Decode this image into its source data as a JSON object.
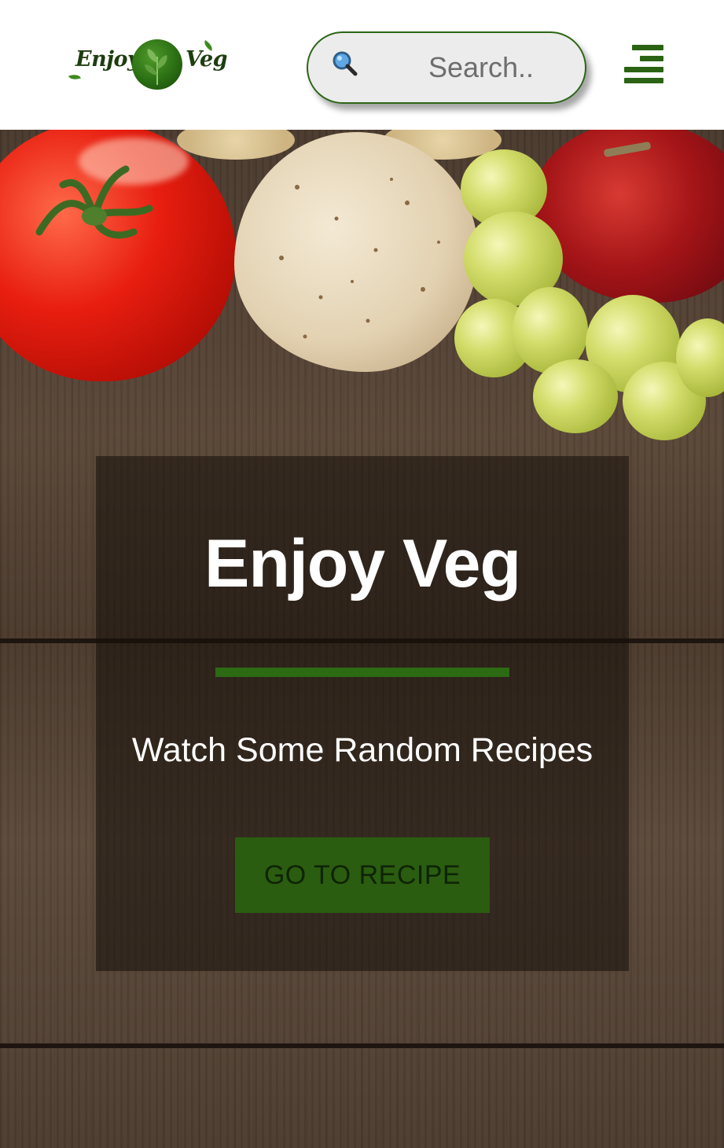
{
  "header": {
    "logo": {
      "word_left": "Enjoy",
      "word_right": "Veg"
    },
    "search": {
      "placeholder": "Search..",
      "icon": "magnifier-icon"
    },
    "menu": {
      "icon": "hamburger-menu-icon"
    }
  },
  "hero": {
    "title": "Enjoy Veg",
    "subtitle": "Watch Some Random Recipes",
    "button_label": "GO TO RECIPE"
  },
  "colors": {
    "brand_green": "#2b6314",
    "header_bg": "#ffffff",
    "search_bg": "#ececec"
  }
}
